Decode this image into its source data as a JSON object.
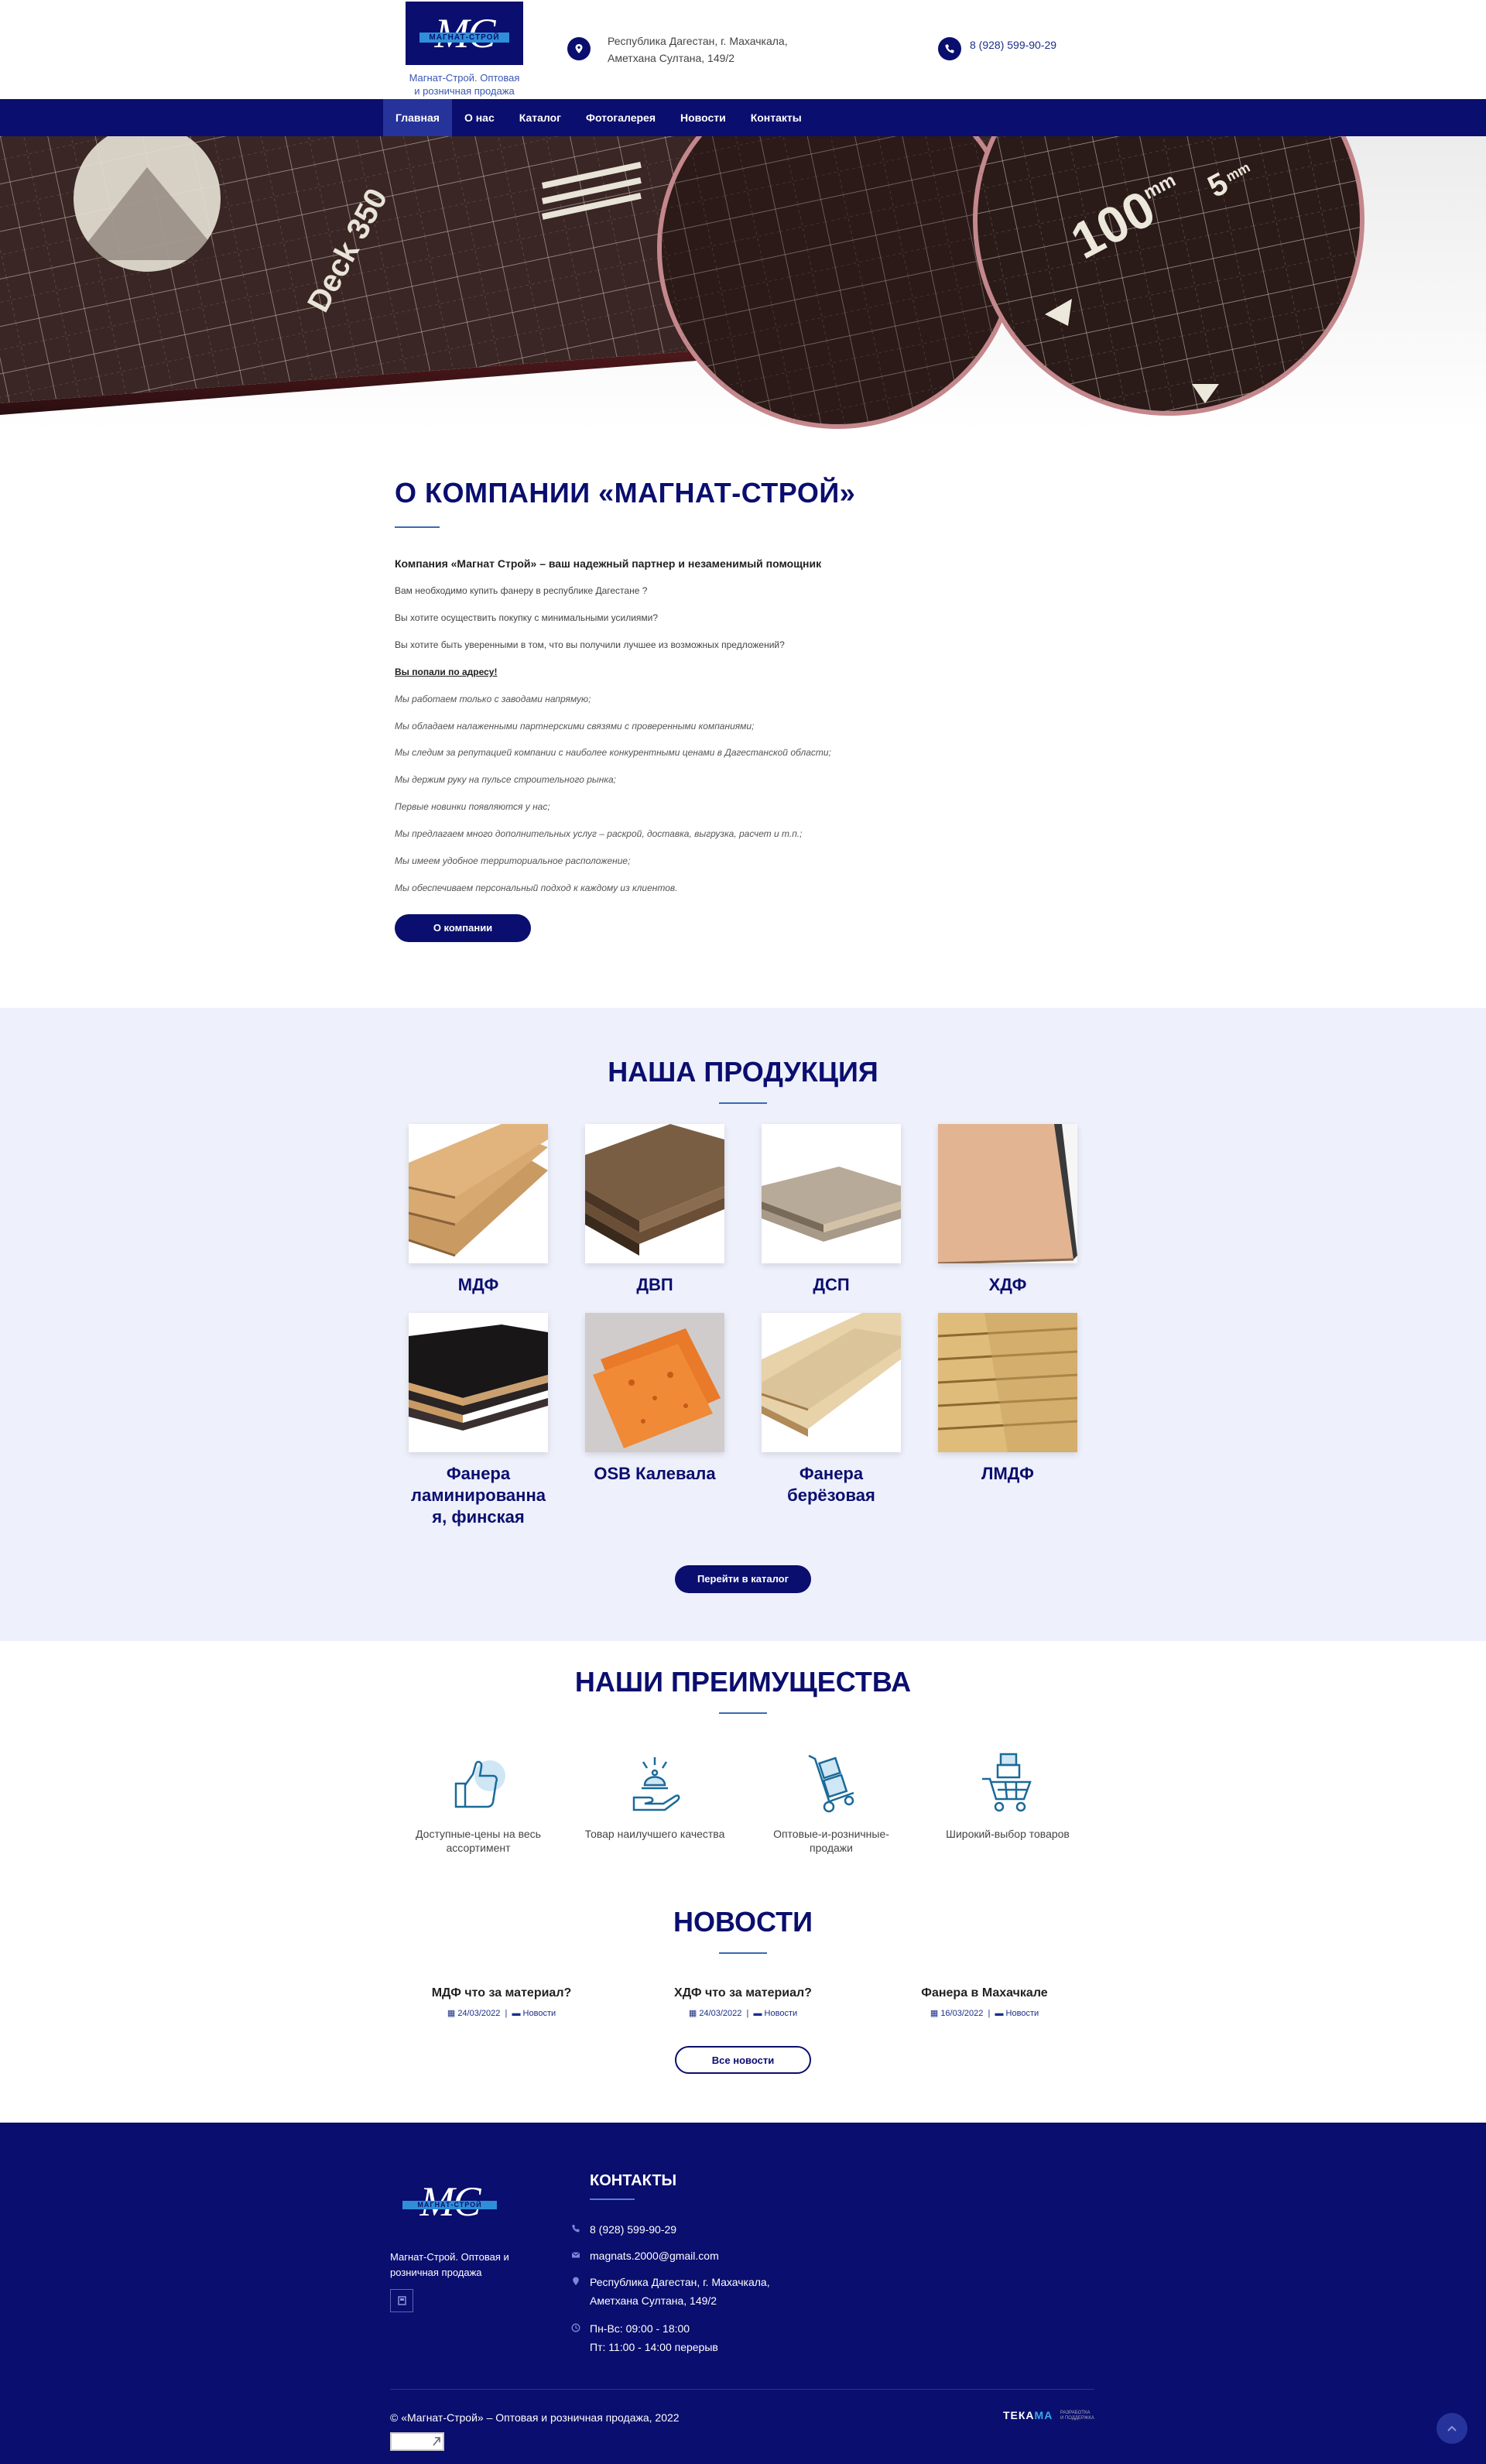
{
  "header": {
    "logo_letters": "MC",
    "logo_strip": "МАГНАТ-СТРОЙ",
    "logo_caption": "Магнат-Строй. Оптовая и розничная продажа",
    "address_line1": "Республика Дагестан, г. Махачкала,",
    "address_line2": "Аметхана Султана, 149/2",
    "phone": "8 (928) 599-90-29"
  },
  "nav": {
    "items": [
      "Главная",
      "О нас",
      "Каталог",
      "Фотогалерея",
      "Новости",
      "Контакты"
    ]
  },
  "hero": {
    "board_text": "Deck 350",
    "lens_text": "100",
    "lens_unit": "mm",
    "lens_text2": "5",
    "lens_unit2": "mm"
  },
  "about": {
    "title": "О КОМПАНИИ «МАГНАТ-СТРОЙ»",
    "lead": "Компания «Магнат Строй» – ваш надежный партнер и незаменимый помощник",
    "q1": "Вам необходимо купить фанеру в республике Дагестане ?",
    "q2": "Вы хотите осуществить покупку с минимальными усилиями?",
    "q3": "Вы хотите быть уверенными в том, что вы получили лучшее из возможных предложений?",
    "right_place": "Вы попали по адресу!",
    "points": [
      "Мы работаем только с заводами напрямую;",
      "Мы обладаем налаженными партнерскими связями с проверенными компаниями;",
      "Мы следим за репутацией компании с наиболее конкурентными ценами в Дагестанской области;",
      "Мы держим руку на пульсе строительного рынка;",
      "Первые новинки появляются у нас;",
      "Мы предлагаем много дополнительных услуг – раскрой, доставка, выгрузка, расчет и т.п.;",
      "Мы имеем удобное территориальное расположение;",
      "Мы обеспечиваем персональный подход к каждому из клиентов."
    ],
    "button": "О компании"
  },
  "products": {
    "title": "НАША ПРОДУКЦИЯ",
    "items": [
      {
        "name": "МДФ"
      },
      {
        "name": "ДВП"
      },
      {
        "name": "ДСП"
      },
      {
        "name": "ХДФ"
      },
      {
        "name": "Фанера ламинированна я, финская"
      },
      {
        "name": "OSB Калевала"
      },
      {
        "name": "Фанера берёзовая"
      },
      {
        "name": "ЛМДФ"
      }
    ],
    "button": "Перейти в каталог"
  },
  "advantages": {
    "title": "НАШИ ПРЕИМУЩЕСТВА",
    "items": [
      {
        "label": "Доступные-цены на весь ассортимент",
        "icon": "thumbs-up-icon"
      },
      {
        "label": "Товар наилучшего качества",
        "icon": "bell-hand-icon"
      },
      {
        "label": "Оптовые-и-розничные-продажи",
        "icon": "hand-truck-icon"
      },
      {
        "label": "Широкий-выбор товаров",
        "icon": "shopping-cart-icon"
      }
    ]
  },
  "news": {
    "title": "НОВОСТИ",
    "items": [
      {
        "title": "МДФ что за материал?",
        "date": "24/03/2022",
        "category": "Новости"
      },
      {
        "title": "ХДФ что за материал?",
        "date": "24/03/2022",
        "category": "Новости"
      },
      {
        "title": "Фанера в Махачкале",
        "date": "16/03/2022",
        "category": "Новости"
      }
    ],
    "separator": "|",
    "button": "Все новости"
  },
  "footer": {
    "logo_letters": "MC",
    "logo_strip": "МАГНАТ-СТРОЙ",
    "caption": "Магнат-Строй. Оптовая и розничная продажа",
    "contacts_title": "КОНТАКТЫ",
    "phone": "8 (928) 599-90-29",
    "email": "magnats.2000@gmail.com",
    "address_line1": "Республика Дагестан, г. Махачкала,",
    "address_line2": "Аметхана Султана, 149/2",
    "hours_line1": "Пн-Вс: 09:00 - 18:00",
    "hours_line2": "Пт: 11:00 - 14:00 перерыв",
    "copyright": "© «Магнат-Строй» – Оптовая и розничная продажа, 2022",
    "dev_brand": "ТЕКА",
    "dev_brand_accent": "MA",
    "dev_sub1": "РАЗРАБОТКА",
    "dev_sub2": "И ПОДДЕРЖКА"
  },
  "colors": {
    "primary": "#0a0e6e",
    "accent_blue": "#3a56b4",
    "products_bg": "#eef0fb"
  }
}
